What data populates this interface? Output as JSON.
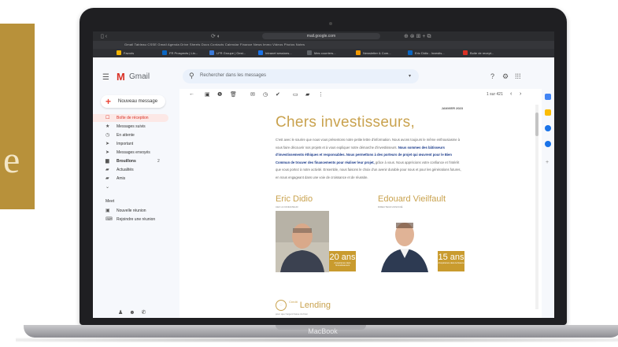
{
  "decor": {
    "gold_letter": "e",
    "gold_color": "#b8913a"
  },
  "laptop": {
    "brand": "MacBook"
  },
  "browser": {
    "address": "mail.google.com",
    "bookmarks_text": "Gmail  Tableau CSSE  Gmail  Agenda  Drive  Sheets  Docs  Contacts  Calendar  Finance  News  Immo  Videos  Photos  Notes",
    "tabs": [
      {
        "label": "Favoris",
        "color": "#f4b400"
      },
      {
        "label": "FR Prospects | Lin...",
        "color": "#0a66c2"
      },
      {
        "label": "LFR Groupe | Gest...",
        "color": "#3c7bd9"
      },
      {
        "label": "Intranet sessions...",
        "color": "#1a73e8"
      },
      {
        "label": "Mes courriers...",
        "color": "#5f6368"
      },
      {
        "label": "Newsletter & Com...",
        "color": "#f29900"
      },
      {
        "label": "Eric Didio - Investis...",
        "color": "#0a66c2"
      },
      {
        "label": "Boite de recept...",
        "color": "#d93025"
      }
    ]
  },
  "gmail": {
    "logo_letter": "M",
    "brand": "Gmail",
    "search_placeholder": "Rechercher dans les messages",
    "compose_label": "Nouveau message",
    "nav": [
      {
        "icon": "inbox-icon",
        "glyph": "☐",
        "label": "Boîte de réception",
        "active": true,
        "bold": false
      },
      {
        "icon": "star-icon",
        "glyph": "★",
        "label": "Messages suivis",
        "active": false,
        "bold": false
      },
      {
        "icon": "clock-icon",
        "glyph": "◷",
        "label": "En attente",
        "active": false,
        "bold": false
      },
      {
        "icon": "important-icon",
        "glyph": "➤",
        "label": "Important",
        "active": false,
        "bold": false
      },
      {
        "icon": "send-icon",
        "glyph": "➤",
        "label": "Messages envoyés",
        "active": false,
        "bold": false
      },
      {
        "icon": "draft-icon",
        "glyph": "▆",
        "label": "Brouillons",
        "active": false,
        "bold": true,
        "count": "2"
      },
      {
        "icon": "label-icon",
        "glyph": "▰",
        "label": "Actualités",
        "active": false,
        "bold": false
      },
      {
        "icon": "label-icon",
        "glyph": "▰",
        "label": "Amis",
        "active": false,
        "bold": false
      },
      {
        "icon": "more-icon",
        "glyph": "⌄",
        "label": "",
        "active": false,
        "bold": false
      }
    ],
    "meet_title": "Meet",
    "meet_items": [
      {
        "icon": "video-icon",
        "glyph": "▣",
        "label": "Nouvelle réunion"
      },
      {
        "icon": "keyboard-icon",
        "glyph": "⌨",
        "label": "Rejoindre une réunion"
      }
    ],
    "pager": "1 sur 421"
  },
  "newsletter": {
    "date": "JANVIER 2023",
    "title": "Chers investisseurs,",
    "body_1": "C'est avec le sourire que nous vous présentons notre petite lettre d'information. Nous avons toujours le même enthousiasme à vous faire découvrir nos projets et à vous expliquer notre démarche d'investisseurs.",
    "body_2": "Nous sommes des bâtisseurs d'investissements éthiques et responsables. Nous permettons à des porteurs de projet qui œuvrent pour le Bien Commun de trouver des financements pour réaliser leur projet,",
    "body_3": "grâce à vous. Nous apprécions votre confiance et l'intérêt que vous portez à notre activité. Ensemble, nous faisons le choix d'un avenir durable pour nous et pour les générations futures, en nous engageant dans une voie de croissance et de réussite.",
    "person_1": {
      "name": "Eric Didio",
      "role": "CEO & FONDATEUR",
      "years": "20 ans",
      "caption": "d'expérience dans l'investissement"
    },
    "person_2": {
      "name": "Edouard Vieilfault",
      "role": "DIRECTEUR ASSOCIÉ",
      "years": "15 ans",
      "caption": "d'expérience dans la finance"
    },
    "logo_small": "Credit",
    "logo": "Lending",
    "logo_sub": "pour que l'argent fasse du bien"
  }
}
